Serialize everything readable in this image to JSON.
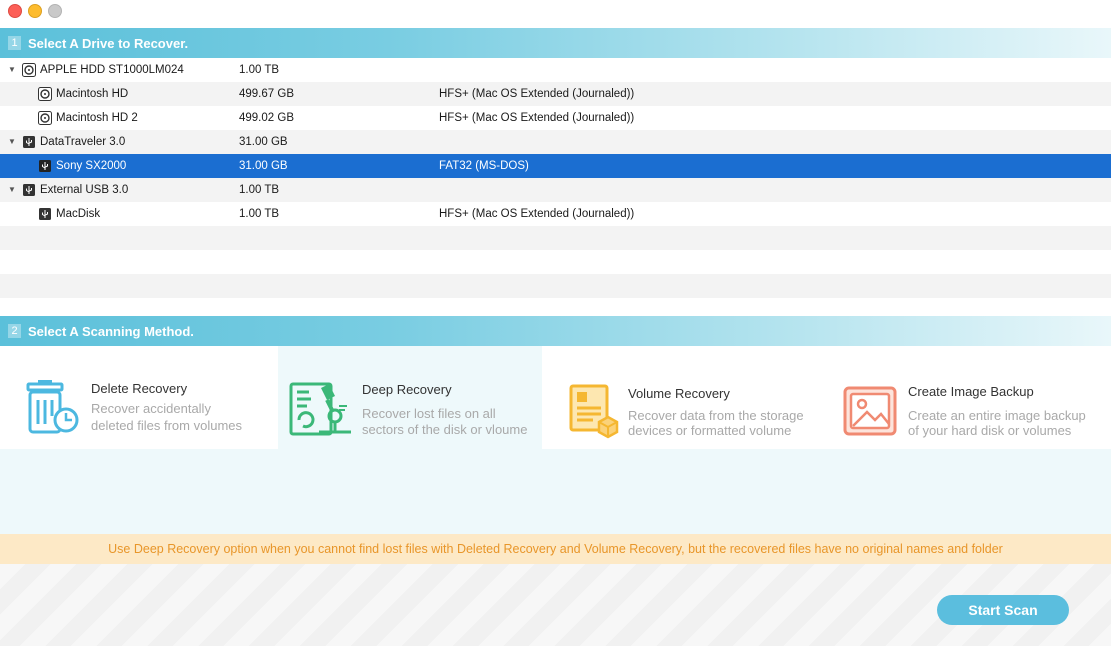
{
  "window": {
    "controls": [
      "close",
      "minimize",
      "zoom"
    ]
  },
  "step1": {
    "number": "1",
    "title": "Select A Drive to Recover."
  },
  "drives": [
    {
      "name": "APPLE HDD ST1000LM024",
      "size": "1.00 TB",
      "fs": "",
      "level": 0,
      "icon": "hard-disk-icon"
    },
    {
      "name": "Macintosh HD",
      "size": "499.67 GB",
      "fs": "HFS+ (Mac OS Extended (Journaled))",
      "level": 1,
      "icon": "hard-disk-icon"
    },
    {
      "name": "Macintosh HD 2",
      "size": "499.02 GB",
      "fs": "HFS+ (Mac OS Extended (Journaled))",
      "level": 1,
      "icon": "hard-disk-icon"
    },
    {
      "name": "DataTraveler 3.0",
      "size": "31.00 GB",
      "fs": "",
      "level": 0,
      "icon": "usb-icon"
    },
    {
      "name": "Sony SX2000",
      "size": "31.00 GB",
      "fs": "FAT32 (MS-DOS)",
      "level": 1,
      "icon": "usb-icon",
      "selected": true
    },
    {
      "name": "External USB 3.0",
      "size": "1.00 TB",
      "fs": "",
      "level": 0,
      "icon": "usb-icon"
    },
    {
      "name": "MacDisk",
      "size": "1.00 TB",
      "fs": "HFS+ (Mac OS Extended (Journaled))",
      "level": 1,
      "icon": "usb-icon"
    }
  ],
  "step2": {
    "number": "2",
    "title": "Select A Scanning Method."
  },
  "methods": [
    {
      "title": "Delete Recovery",
      "desc1": "Recover accidentally",
      "desc2": "deleted files from volumes",
      "icon": "trash-clock-icon",
      "color": "#4cb8e0"
    },
    {
      "title": "Deep Recovery",
      "desc1": "Recover lost files on all",
      "desc2": "sectors of the disk or vloume",
      "icon": "microscope-document-icon",
      "color": "#3bb878",
      "selected": true
    },
    {
      "title": "Volume Recovery",
      "desc1": "Recover data from the storage",
      "desc2": "devices or formatted volume",
      "icon": "document-box-icon",
      "color": "#f5b731"
    },
    {
      "title": "Create Image Backup",
      "desc1": "Create an entire image backup",
      "desc2": "of your hard disk or volumes",
      "icon": "image-icon",
      "color": "#f08a72"
    }
  ],
  "tip": "Use Deep Recovery option when you cannot find lost files with Deleted Recovery and Volume Recovery, but the recovered files have no original names and folder",
  "start_button": "Start Scan",
  "colors": {
    "accent": "#5bbede",
    "selected_row": "#1b6ed1",
    "tip_bg": "#fde9c6",
    "tip_text": "#e8962a"
  }
}
